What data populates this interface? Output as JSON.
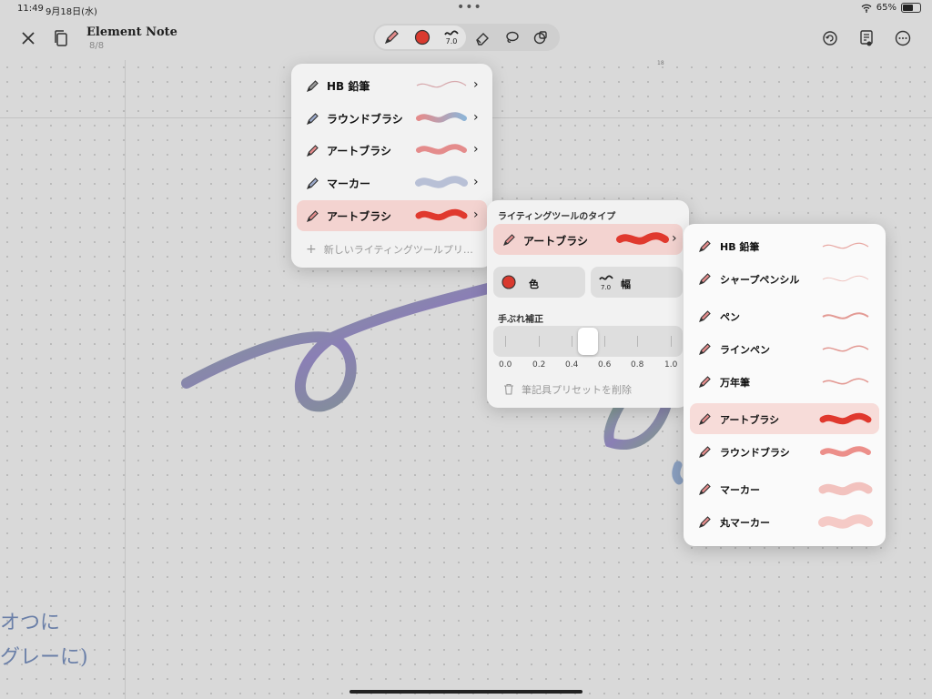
{
  "status": {
    "time": "11:49",
    "date": "9月18日(水)",
    "battery": "65%",
    "battery_level": 0.65
  },
  "document": {
    "title": "Element Note",
    "page": "8/8"
  },
  "toolbar": {
    "width_value": "7.0"
  },
  "canvas": {
    "corner_mark": "18",
    "handwriting_line1": "オつに",
    "handwriting_line2": "グレーに)"
  },
  "preset_menu": {
    "items": [
      {
        "label": "HB 鉛筆",
        "color": "#c98b92",
        "stroke": "thin"
      },
      {
        "label": "ラウンドブラシ",
        "color": "#c98b92",
        "stroke": "gradient"
      },
      {
        "label": "アートブラシ",
        "color": "#e48c8c",
        "stroke": "medium"
      },
      {
        "label": "マーカー",
        "color": "#aab4cc",
        "stroke": "marker"
      },
      {
        "label": "アートブラシ",
        "color": "#e0392e",
        "stroke": "bold",
        "selected": true
      }
    ],
    "new_label": "新しいライティングツールプリ…"
  },
  "settings": {
    "type_heading": "ライティングツールのタイプ",
    "current_type": "アートブラシ",
    "color_label": "色",
    "color_value": "#d93a2f",
    "width_label": "幅",
    "width_value": "7.0",
    "stabilization_label": "手ぶれ補正",
    "stabilization_value": 0.5,
    "scale": [
      "0.0",
      "0.2",
      "0.4",
      "0.6",
      "0.8",
      "1.0"
    ],
    "delete_label": "筆記具プリセットを削除"
  },
  "type_menu": {
    "items": [
      {
        "label": "HB 鉛筆",
        "stroke": "thin"
      },
      {
        "label": "シャープペンシル",
        "stroke": "thin"
      },
      {
        "label": "ペン",
        "stroke": "medium"
      },
      {
        "label": "ラインペン",
        "stroke": "medium"
      },
      {
        "label": "万年筆",
        "stroke": "medium"
      },
      {
        "label": "アートブラシ",
        "stroke": "bold",
        "selected": true
      },
      {
        "label": "ラウンドブラシ",
        "stroke": "round"
      },
      {
        "label": "マーカー",
        "stroke": "marker"
      },
      {
        "label": "丸マーカー",
        "stroke": "marker"
      }
    ]
  }
}
